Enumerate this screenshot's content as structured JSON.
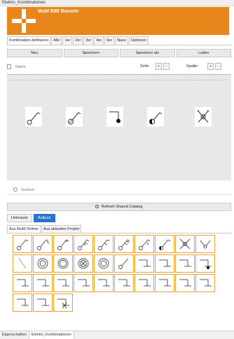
{
  "window": {
    "title": "Elektro_Kombinationen"
  },
  "banner": {
    "title": "MuM BIM Booster",
    "accent": "#e8861c"
  },
  "top_tabs": [
    {
      "label": "Kombination definieren"
    },
    {
      "label": "Alle"
    },
    {
      "label": "1er"
    },
    {
      "label": "2er"
    },
    {
      "label": "3er"
    },
    {
      "label": "4er"
    },
    {
      "label": "6er"
    },
    {
      "label": "Nass"
    },
    {
      "label": "Optionen"
    }
  ],
  "actions": {
    "new": "Neu",
    "save": "Speichern",
    "save_as": "Speichern als",
    "load": "Laden"
  },
  "name_row": {
    "placeholder": "Name",
    "row_label": "Zeile:",
    "col_label": "Spalte:",
    "plus": "+",
    "minus": "-"
  },
  "canvas": {
    "symbols": [
      "switch-1",
      "dimmer-switch",
      "socket-dot",
      "half-filled-switch",
      "cross-switch"
    ]
  },
  "search": {
    "placeholder": "Suchen"
  },
  "refresh": {
    "label": "Refresh Shared Catalog"
  },
  "mode": {
    "concealed": "Unterputz",
    "surface": "Aufputz",
    "active_color": "#2b73cf"
  },
  "source_tabs": {
    "mum": "Aus MuM Ordner",
    "project": "Aus aktuelles Projekt"
  },
  "grid": {
    "accent": "#f0a030",
    "symbols": [
      "switch-1",
      "switch-2",
      "switch-3",
      "switch-4",
      "switch-5",
      "switch-6",
      "switch-t",
      "switch-half",
      "switch-cross",
      "switch-v",
      "line-diagonal",
      "circle-double",
      "circle-double-2",
      "circle-cross",
      "circle-double-3",
      "switch-diag-circle",
      "socket-1",
      "socket-2",
      "socket-3",
      "socket-dot",
      "socket-4",
      "socket-5",
      "socket-6",
      "socket-7",
      "socket-8",
      "socket-9",
      "socket-10",
      "socket-11",
      "socket-12",
      "socket-13",
      "socket-14",
      "socket-15",
      "socket-x"
    ]
  },
  "status_tabs": {
    "properties": "Eigenschaften",
    "combinations": "Elektro_Kombinationen"
  }
}
